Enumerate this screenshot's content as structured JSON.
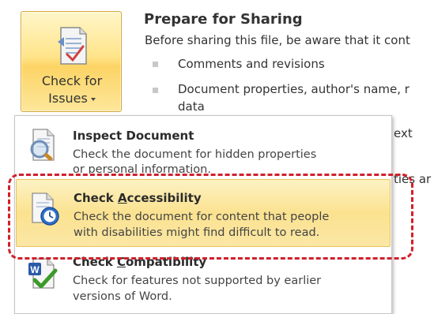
{
  "ribbon_button": {
    "label_line1": "Check for",
    "label_line2": "Issues"
  },
  "panel": {
    "title": "Prepare for Sharing",
    "description": "Before sharing this file, be aware that it cont",
    "bullets": [
      "Comments and revisions",
      "Document properties, author's name, r",
      "data"
    ],
    "peek_text_1": "ext",
    "peek_text_2": "ties ar"
  },
  "menu": {
    "items": [
      {
        "title": "Inspect Document",
        "desc_line1": "Check the document for hidden properties",
        "desc_line2": "or personal information."
      },
      {
        "title_pre": "Check ",
        "title_accel": "A",
        "title_post": "ccessibility",
        "desc_line1": "Check the document for content that people",
        "desc_line2": "with disabilities might find difficult to read."
      },
      {
        "title_pre": "Check ",
        "title_accel": "C",
        "title_post": "ompatibility",
        "desc_line1": "Check for features not supported by earlier",
        "desc_line2": "versions of Word."
      }
    ]
  },
  "colors": {
    "highlight_border": "#d0202b",
    "button_gold": "#fcd465",
    "menu_hover": "#fbe290"
  },
  "icons": {
    "ribbon_button": "document-check-icon",
    "inspect": "inspect-document-icon",
    "accessibility": "accessibility-check-icon",
    "compatibility": "word-compatibility-icon"
  }
}
